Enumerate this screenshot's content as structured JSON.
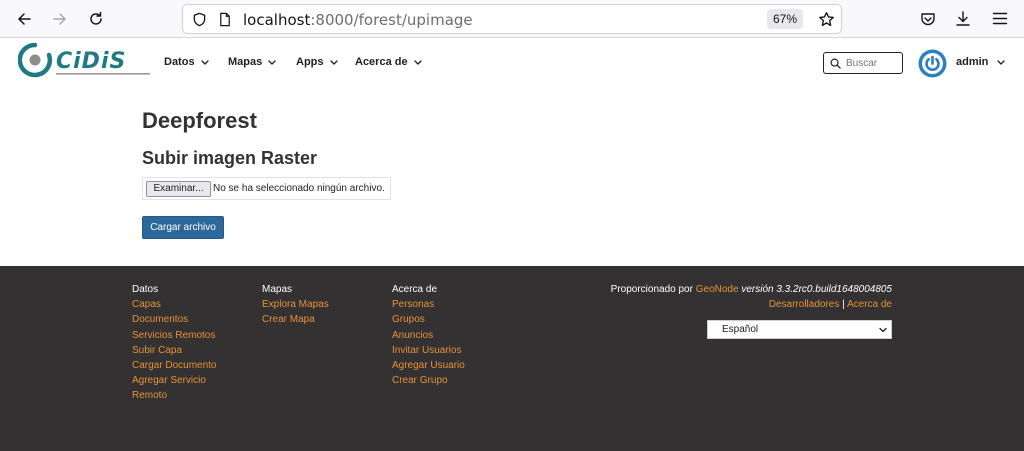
{
  "browser": {
    "url_host": "localhost",
    "url_rest": ":8000/forest/upimage",
    "zoom": "67%"
  },
  "header": {
    "menu": [
      {
        "label": "Datos"
      },
      {
        "label": "Mapas"
      },
      {
        "label": "Apps"
      },
      {
        "label": "Acerca de"
      }
    ],
    "search_placeholder": "Buscar",
    "user": "admin"
  },
  "main": {
    "title": "Deepforest",
    "section_title": "Subir imagen Raster",
    "file_button": "Examinar...",
    "file_status": "No se ha seleccionado ningún archivo.",
    "upload_button": "Cargar archivo"
  },
  "footer": {
    "columns": [
      {
        "heading": "Datos",
        "links": [
          "Capas",
          "Documentos",
          "Servicios Remotos",
          "Subir Capa",
          "Cargar Documento",
          "Agregar Servicio",
          "Remoto"
        ]
      },
      {
        "heading": "Mapas",
        "links": [
          "Explora Mapas",
          "Crear Mapa"
        ]
      },
      {
        "heading": "Acerca de",
        "links": [
          "Personas",
          "Grupos",
          "Anuncios",
          "Invitar Usuarios",
          "Agregar Usuario",
          "Crear Grupo"
        ]
      }
    ],
    "powered_by": "Proporcionado por",
    "geonode": "GeoNode",
    "version": "versión 3.3.2rc0.build1648004805",
    "developers": "Desarrolladores",
    "separator": "|",
    "about": "Acerca de",
    "language": "Español"
  },
  "colors": {
    "accent": "#2c689c",
    "footer_bg": "#333131",
    "footer_link": "#e69138",
    "logo_teal": "#1f7a82"
  }
}
